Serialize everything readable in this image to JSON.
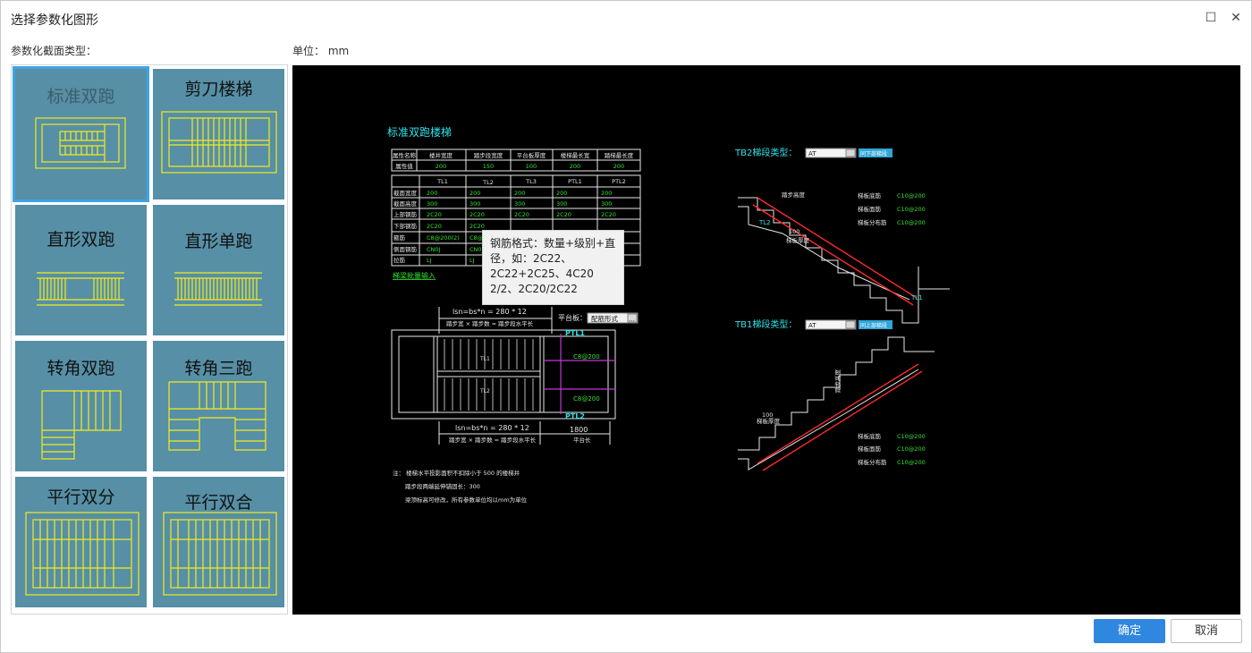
{
  "window": {
    "title": "选择参数化图形"
  },
  "labels": {
    "section_type": "参数化截面类型：",
    "unit": "单位：  mm"
  },
  "thumbnails": [
    {
      "name": "标准双跑"
    },
    {
      "name": "剪刀楼梯"
    },
    {
      "name": "直形双跑"
    },
    {
      "name": "直形单跑"
    },
    {
      "name": "转角双跑"
    },
    {
      "name": "转角三跑"
    },
    {
      "name": "平行双分"
    },
    {
      "name": "平行双合"
    }
  ],
  "selected_thumbnail": "标准双跑",
  "drawing": {
    "title": "标准双跑楼梯",
    "table1": {
      "headers": [
        "属性名称",
        "楼井宽度",
        "踏步段宽度",
        "平台板厚度",
        "楼梯最长宽",
        "踏梯最长度"
      ],
      "row_label": "属性值",
      "values": [
        "200",
        "150",
        "100",
        "200",
        "200"
      ]
    },
    "table2": {
      "headers": [
        "",
        "TL1",
        "TL2",
        "TL3",
        "PTL1",
        "PTL2"
      ],
      "rows": [
        {
          "label": "截面宽度",
          "values": [
            "200",
            "200",
            "200",
            "200",
            "200"
          ]
        },
        {
          "label": "截面高度",
          "values": [
            "300",
            "300",
            "300",
            "300",
            "300"
          ]
        },
        {
          "label": "上部钢筋",
          "values": [
            "2C20",
            "2C20",
            "2C20",
            "2C20",
            "2C20"
          ]
        },
        {
          "label": "下部钢筋",
          "values": [
            "2C20",
            "2C20",
            "",
            "",
            ""
          ]
        },
        {
          "label": "箍筋",
          "values": [
            "C8@200(2)",
            "C8@",
            "",
            "",
            ""
          ]
        },
        {
          "label": "侧面钢筋",
          "values": [
            "CN0J",
            "CN0J",
            "",
            "",
            ""
          ]
        },
        {
          "label": "拉筋",
          "values": [
            "LJ",
            "LJ",
            "",
            "",
            ""
          ]
        }
      ]
    },
    "link_continuous": "梯梁批量输入",
    "platform_label": "平台板：",
    "platform_value": "配筋形式",
    "dim_top": "lsn=bs*n = 280 * 12",
    "dim_top_sub": "踏步宽 × 踏步数 = 踏步段水平长",
    "dim_bottom": "lsn=bs*n = 280 * 12",
    "dim_bottom_sub": "踏步宽 × 踏步数 = 踏步段水平长",
    "platform_len": "1800",
    "platform_len_sub": "平台长",
    "rebar_label": "C8@200",
    "beam_labels": {
      "ptl1": "PTL1",
      "ptl2": "PTL2",
      "tl1": "TL1",
      "tl2": "TL2"
    },
    "notes": [
      "注：  楼梯水平投影面积不扣除小于 500 的楼梯井",
      "踏步段两端延伸锚固长：300",
      "梁顶标高可修改，所有参数单位均以mm为单位"
    ],
    "tb2": {
      "label": "TB2梯段类型：",
      "value": "AT",
      "button": "同下部梯段",
      "labels": [
        "踏步高度",
        "梯板底筋",
        "梯板面筋",
        "梯板分布筋",
        "梯板厚度"
      ],
      "bars": [
        "C10@200",
        "C10@200",
        "C10@200"
      ],
      "beams": [
        "TL2",
        "TL1"
      ],
      "thickness": "100"
    },
    "tb1": {
      "label": "TB1梯段类型：",
      "value": "AT",
      "button": "同上部梯段",
      "labels": [
        "踏步高度",
        "梯板厚度",
        "梯板底筋",
        "梯板面筋",
        "梯板分布筋"
      ],
      "bars": [
        "C10@200",
        "C10@200",
        "C10@200"
      ],
      "thickness": "100"
    }
  },
  "tooltip": {
    "lines": [
      "钢筋格式：数量+级别+直",
      "径，如：2C22、",
      "2C22+2C25、4C20",
      "2/2、2C20/2C22"
    ]
  },
  "buttons": {
    "ok": "确定",
    "cancel": "取消"
  }
}
